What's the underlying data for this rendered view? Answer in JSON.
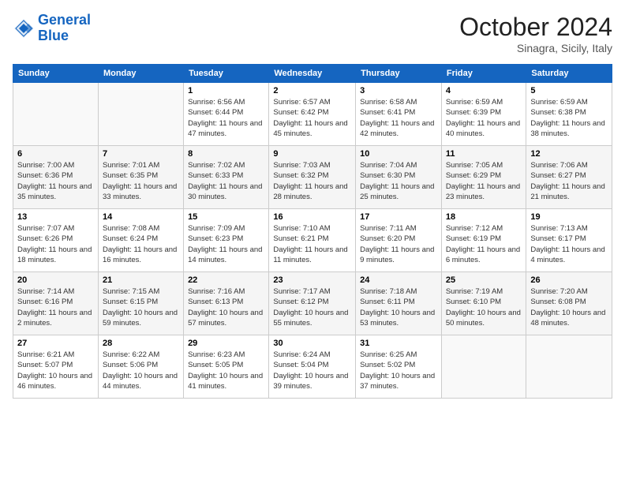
{
  "header": {
    "logo_line1": "General",
    "logo_line2": "Blue",
    "month": "October 2024",
    "location": "Sinagra, Sicily, Italy"
  },
  "weekdays": [
    "Sunday",
    "Monday",
    "Tuesday",
    "Wednesday",
    "Thursday",
    "Friday",
    "Saturday"
  ],
  "weeks": [
    [
      {
        "day": "",
        "info": ""
      },
      {
        "day": "",
        "info": ""
      },
      {
        "day": "1",
        "info": "Sunrise: 6:56 AM\nSunset: 6:44 PM\nDaylight: 11 hours and 47 minutes."
      },
      {
        "day": "2",
        "info": "Sunrise: 6:57 AM\nSunset: 6:42 PM\nDaylight: 11 hours and 45 minutes."
      },
      {
        "day": "3",
        "info": "Sunrise: 6:58 AM\nSunset: 6:41 PM\nDaylight: 11 hours and 42 minutes."
      },
      {
        "day": "4",
        "info": "Sunrise: 6:59 AM\nSunset: 6:39 PM\nDaylight: 11 hours and 40 minutes."
      },
      {
        "day": "5",
        "info": "Sunrise: 6:59 AM\nSunset: 6:38 PM\nDaylight: 11 hours and 38 minutes."
      }
    ],
    [
      {
        "day": "6",
        "info": "Sunrise: 7:00 AM\nSunset: 6:36 PM\nDaylight: 11 hours and 35 minutes."
      },
      {
        "day": "7",
        "info": "Sunrise: 7:01 AM\nSunset: 6:35 PM\nDaylight: 11 hours and 33 minutes."
      },
      {
        "day": "8",
        "info": "Sunrise: 7:02 AM\nSunset: 6:33 PM\nDaylight: 11 hours and 30 minutes."
      },
      {
        "day": "9",
        "info": "Sunrise: 7:03 AM\nSunset: 6:32 PM\nDaylight: 11 hours and 28 minutes."
      },
      {
        "day": "10",
        "info": "Sunrise: 7:04 AM\nSunset: 6:30 PM\nDaylight: 11 hours and 25 minutes."
      },
      {
        "day": "11",
        "info": "Sunrise: 7:05 AM\nSunset: 6:29 PM\nDaylight: 11 hours and 23 minutes."
      },
      {
        "day": "12",
        "info": "Sunrise: 7:06 AM\nSunset: 6:27 PM\nDaylight: 11 hours and 21 minutes."
      }
    ],
    [
      {
        "day": "13",
        "info": "Sunrise: 7:07 AM\nSunset: 6:26 PM\nDaylight: 11 hours and 18 minutes."
      },
      {
        "day": "14",
        "info": "Sunrise: 7:08 AM\nSunset: 6:24 PM\nDaylight: 11 hours and 16 minutes."
      },
      {
        "day": "15",
        "info": "Sunrise: 7:09 AM\nSunset: 6:23 PM\nDaylight: 11 hours and 14 minutes."
      },
      {
        "day": "16",
        "info": "Sunrise: 7:10 AM\nSunset: 6:21 PM\nDaylight: 11 hours and 11 minutes."
      },
      {
        "day": "17",
        "info": "Sunrise: 7:11 AM\nSunset: 6:20 PM\nDaylight: 11 hours and 9 minutes."
      },
      {
        "day": "18",
        "info": "Sunrise: 7:12 AM\nSunset: 6:19 PM\nDaylight: 11 hours and 6 minutes."
      },
      {
        "day": "19",
        "info": "Sunrise: 7:13 AM\nSunset: 6:17 PM\nDaylight: 11 hours and 4 minutes."
      }
    ],
    [
      {
        "day": "20",
        "info": "Sunrise: 7:14 AM\nSunset: 6:16 PM\nDaylight: 11 hours and 2 minutes."
      },
      {
        "day": "21",
        "info": "Sunrise: 7:15 AM\nSunset: 6:15 PM\nDaylight: 10 hours and 59 minutes."
      },
      {
        "day": "22",
        "info": "Sunrise: 7:16 AM\nSunset: 6:13 PM\nDaylight: 10 hours and 57 minutes."
      },
      {
        "day": "23",
        "info": "Sunrise: 7:17 AM\nSunset: 6:12 PM\nDaylight: 10 hours and 55 minutes."
      },
      {
        "day": "24",
        "info": "Sunrise: 7:18 AM\nSunset: 6:11 PM\nDaylight: 10 hours and 53 minutes."
      },
      {
        "day": "25",
        "info": "Sunrise: 7:19 AM\nSunset: 6:10 PM\nDaylight: 10 hours and 50 minutes."
      },
      {
        "day": "26",
        "info": "Sunrise: 7:20 AM\nSunset: 6:08 PM\nDaylight: 10 hours and 48 minutes."
      }
    ],
    [
      {
        "day": "27",
        "info": "Sunrise: 6:21 AM\nSunset: 5:07 PM\nDaylight: 10 hours and 46 minutes."
      },
      {
        "day": "28",
        "info": "Sunrise: 6:22 AM\nSunset: 5:06 PM\nDaylight: 10 hours and 44 minutes."
      },
      {
        "day": "29",
        "info": "Sunrise: 6:23 AM\nSunset: 5:05 PM\nDaylight: 10 hours and 41 minutes."
      },
      {
        "day": "30",
        "info": "Sunrise: 6:24 AM\nSunset: 5:04 PM\nDaylight: 10 hours and 39 minutes."
      },
      {
        "day": "31",
        "info": "Sunrise: 6:25 AM\nSunset: 5:02 PM\nDaylight: 10 hours and 37 minutes."
      },
      {
        "day": "",
        "info": ""
      },
      {
        "day": "",
        "info": ""
      }
    ]
  ]
}
